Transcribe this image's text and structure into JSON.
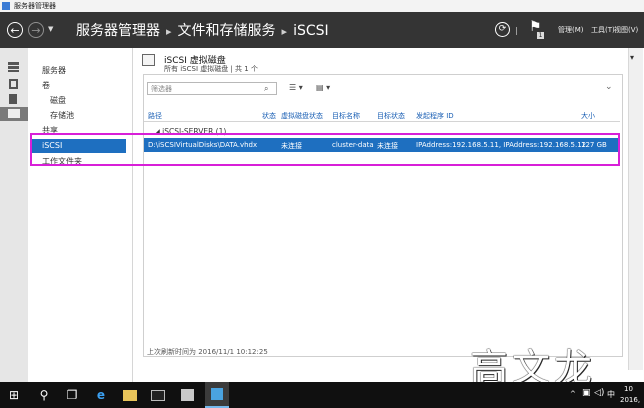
{
  "window": {
    "title": "服务器管理器"
  },
  "header": {
    "breadcrumb": [
      "服务器管理器",
      "文件和存储服务",
      "iSCSI"
    ],
    "menus": {
      "manage": "管理(M)",
      "tools": "工具(T)",
      "view": "视图(V)"
    },
    "notification_count": "1"
  },
  "sidebar": {
    "items": [
      {
        "label": "服务器"
      },
      {
        "label": "卷"
      },
      {
        "label": "磁盘"
      },
      {
        "label": "存储池"
      },
      {
        "label": "共享"
      },
      {
        "label": "iSCSI"
      },
      {
        "label": "工作文件夹"
      }
    ],
    "selected": "iSCSI"
  },
  "panel": {
    "title": "iSCSI 虚拟磁盘",
    "subtitle": "所有 iSCSI 虚拟磁盘 | 共 1 个",
    "filter_placeholder": "筛选器",
    "columns": [
      "路径",
      "状态",
      "虚拟磁盘状态",
      "目标名称",
      "目标状态",
      "发起程序 ID",
      "大小"
    ],
    "group": {
      "label": "iSCSI-SERVER (1)"
    },
    "rows": [
      {
        "path": "D:\\iSCSIVirtualDisks\\DATA.vhdx",
        "status": "",
        "disk_status": "未连接",
        "target_name": "cluster-data",
        "target_status": "未连接",
        "initiator_id": "IPAddress:192.168.5.11, IPAddress:192.168.5.12",
        "size": "127 GB"
      }
    ],
    "last_refresh": "上次刷新时间为 2016/11/1 10:12:25"
  },
  "watermark": "高文龙",
  "taskbar": {
    "ime": "中",
    "time": "10",
    "date": "2016,"
  },
  "colors": {
    "selection": "#1e6fc0",
    "highlight": "#d81fd8",
    "header": "#343434"
  }
}
